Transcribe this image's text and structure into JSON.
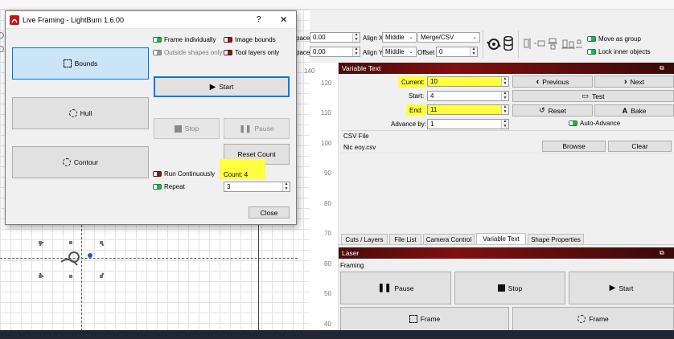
{
  "dialog": {
    "title": "Live Framing - LightBurn 1.6.00",
    "help": "?",
    "close_x": "✕",
    "modes": {
      "bounds": "Bounds",
      "hull": "Hull",
      "contour": "Contour"
    },
    "options": {
      "frame_individually": "Frame individually",
      "image_bounds": "Image bounds",
      "outside_shapes_only": "Outside shapes only",
      "tool_layers_only": "Tool layers only"
    },
    "start": "Start",
    "stop": "Stop",
    "pause": "Pause",
    "reset_count": "Reset Count",
    "run_continuously": "Run Continuously",
    "count": "Count: 4",
    "repeat_label": "Repeat",
    "repeat_value": "3",
    "close": "Close"
  },
  "toolbar": {
    "space_label": "pace",
    "space1": "0.00",
    "space2": "0.00",
    "align_x": "Align X",
    "align_x_value": "Middle",
    "align_y": "Align Y",
    "align_y_value": "Middle",
    "merge": "Merge/CSV",
    "offset": "Offset",
    "offset_value": "0",
    "move_as_group": "Move as group",
    "lock_inner": "Lock inner objects"
  },
  "ruler": {
    "top": "140",
    "marks": [
      "120",
      "110",
      "100",
      "90",
      "80",
      "70",
      "60",
      "50",
      "40"
    ]
  },
  "variable_text": {
    "title": "Variable Text",
    "current_label": "Current:",
    "current": "10",
    "start_label": "Start:",
    "start": "4",
    "end_label": "End:",
    "end": "11",
    "advance_label": "Advance by:",
    "advance": "1",
    "previous": "Previous",
    "next": "Next",
    "test": "Test",
    "reset": "Reset",
    "bake": "Bake",
    "auto_advance": "Auto-Advance",
    "csv_label": "CSV File",
    "csv_file": "Nic eoy.csv",
    "browse": "Browse",
    "clear": "Clear"
  },
  "tabs": [
    "Cuts / Layers",
    "File List",
    "Camera Control",
    "Variable Text",
    "Shape Properties"
  ],
  "laser": {
    "title": "Laser",
    "framing": "Framing",
    "pause": "Pause",
    "stop": "Stop",
    "start": "Start",
    "frame1": "Frame",
    "frame2": "Frame"
  },
  "colors": {
    "highlight": "#ffff3f",
    "accent": "#7e1010",
    "dialog_selected": "#cce4f7"
  }
}
